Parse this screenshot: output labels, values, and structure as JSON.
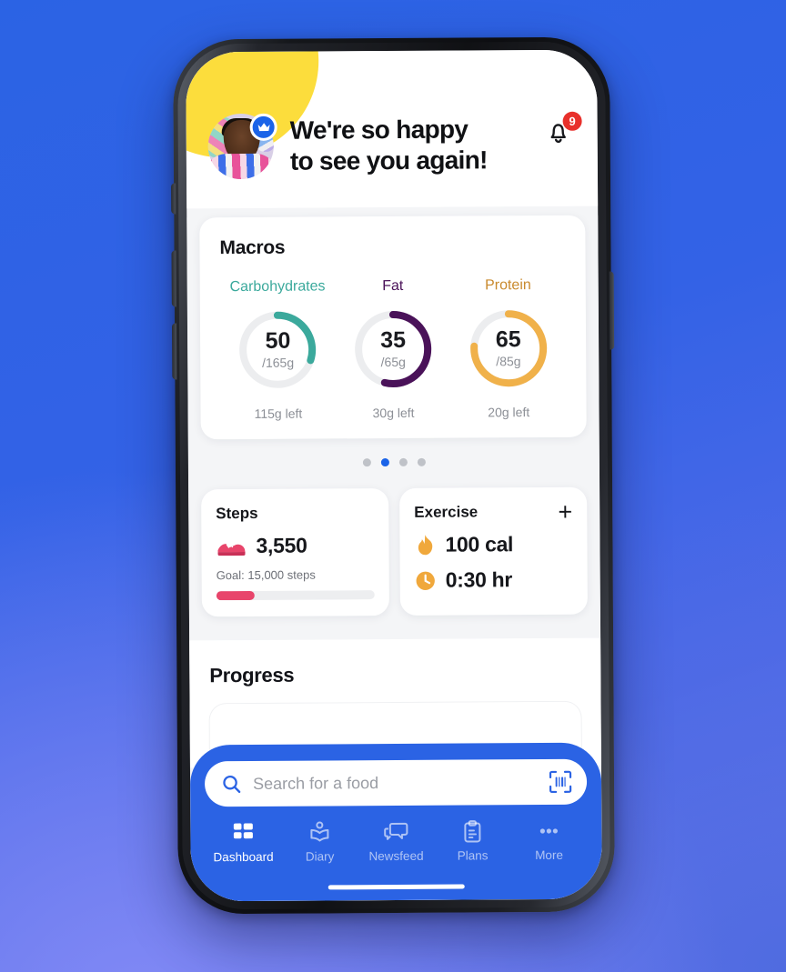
{
  "theme": {
    "brand_blue": "#2B63E4",
    "carb_color": "#3BA99C",
    "fat_color": "#4A1259",
    "protein_color": "#F0B14A",
    "steps_color": "#E8456B",
    "badge_red": "#E8302B",
    "accent_yellow": "#FCDD3C"
  },
  "header": {
    "greeting_line1": "We're so happy",
    "greeting_line2": "to see you again!",
    "notification_count": "9",
    "avatar_name": "user-avatar",
    "crown_icon": "crown-icon",
    "bell_icon": "bell-icon"
  },
  "macros": {
    "title": "Macros",
    "items": [
      {
        "label": "Carbohydrates",
        "value": "50",
        "goal": "/165g",
        "left": "115g left",
        "color": "#3BA99C",
        "percent": 30
      },
      {
        "label": "Fat",
        "value": "35",
        "goal": "/65g",
        "left": "30g left",
        "color": "#4A1259",
        "percent": 54
      },
      {
        "label": "Protein",
        "value": "65",
        "goal": "/85g",
        "left": "20g left",
        "color": "#F0B14A",
        "percent": 76
      }
    ]
  },
  "carousel": {
    "total_dots": 4,
    "active_index": 1
  },
  "steps_card": {
    "title": "Steps",
    "icon": "running-shoe-icon",
    "value": "3,550",
    "goal_text": "Goal: 15,000 steps",
    "progress_percent": 24
  },
  "exercise_card": {
    "title": "Exercise",
    "add_label": "+",
    "rows": [
      {
        "icon": "flame-icon",
        "value": "100 cal"
      },
      {
        "icon": "clock-icon",
        "value": "0:30 hr"
      }
    ]
  },
  "progress_section": {
    "title": "Progress"
  },
  "search": {
    "placeholder": "Search for a food",
    "value": "",
    "search_icon": "search-icon",
    "scan_icon": "barcode-scan-icon"
  },
  "navbar": {
    "items": [
      {
        "label": "Dashboard",
        "icon": "dashboard-grid-icon",
        "active": true
      },
      {
        "label": "Diary",
        "icon": "open-book-icon",
        "active": false
      },
      {
        "label": "Newsfeed",
        "icon": "chat-bubbles-icon",
        "active": false
      },
      {
        "label": "Plans",
        "icon": "clipboard-icon",
        "active": false
      },
      {
        "label": "More",
        "icon": "ellipsis-icon",
        "active": false
      }
    ]
  }
}
